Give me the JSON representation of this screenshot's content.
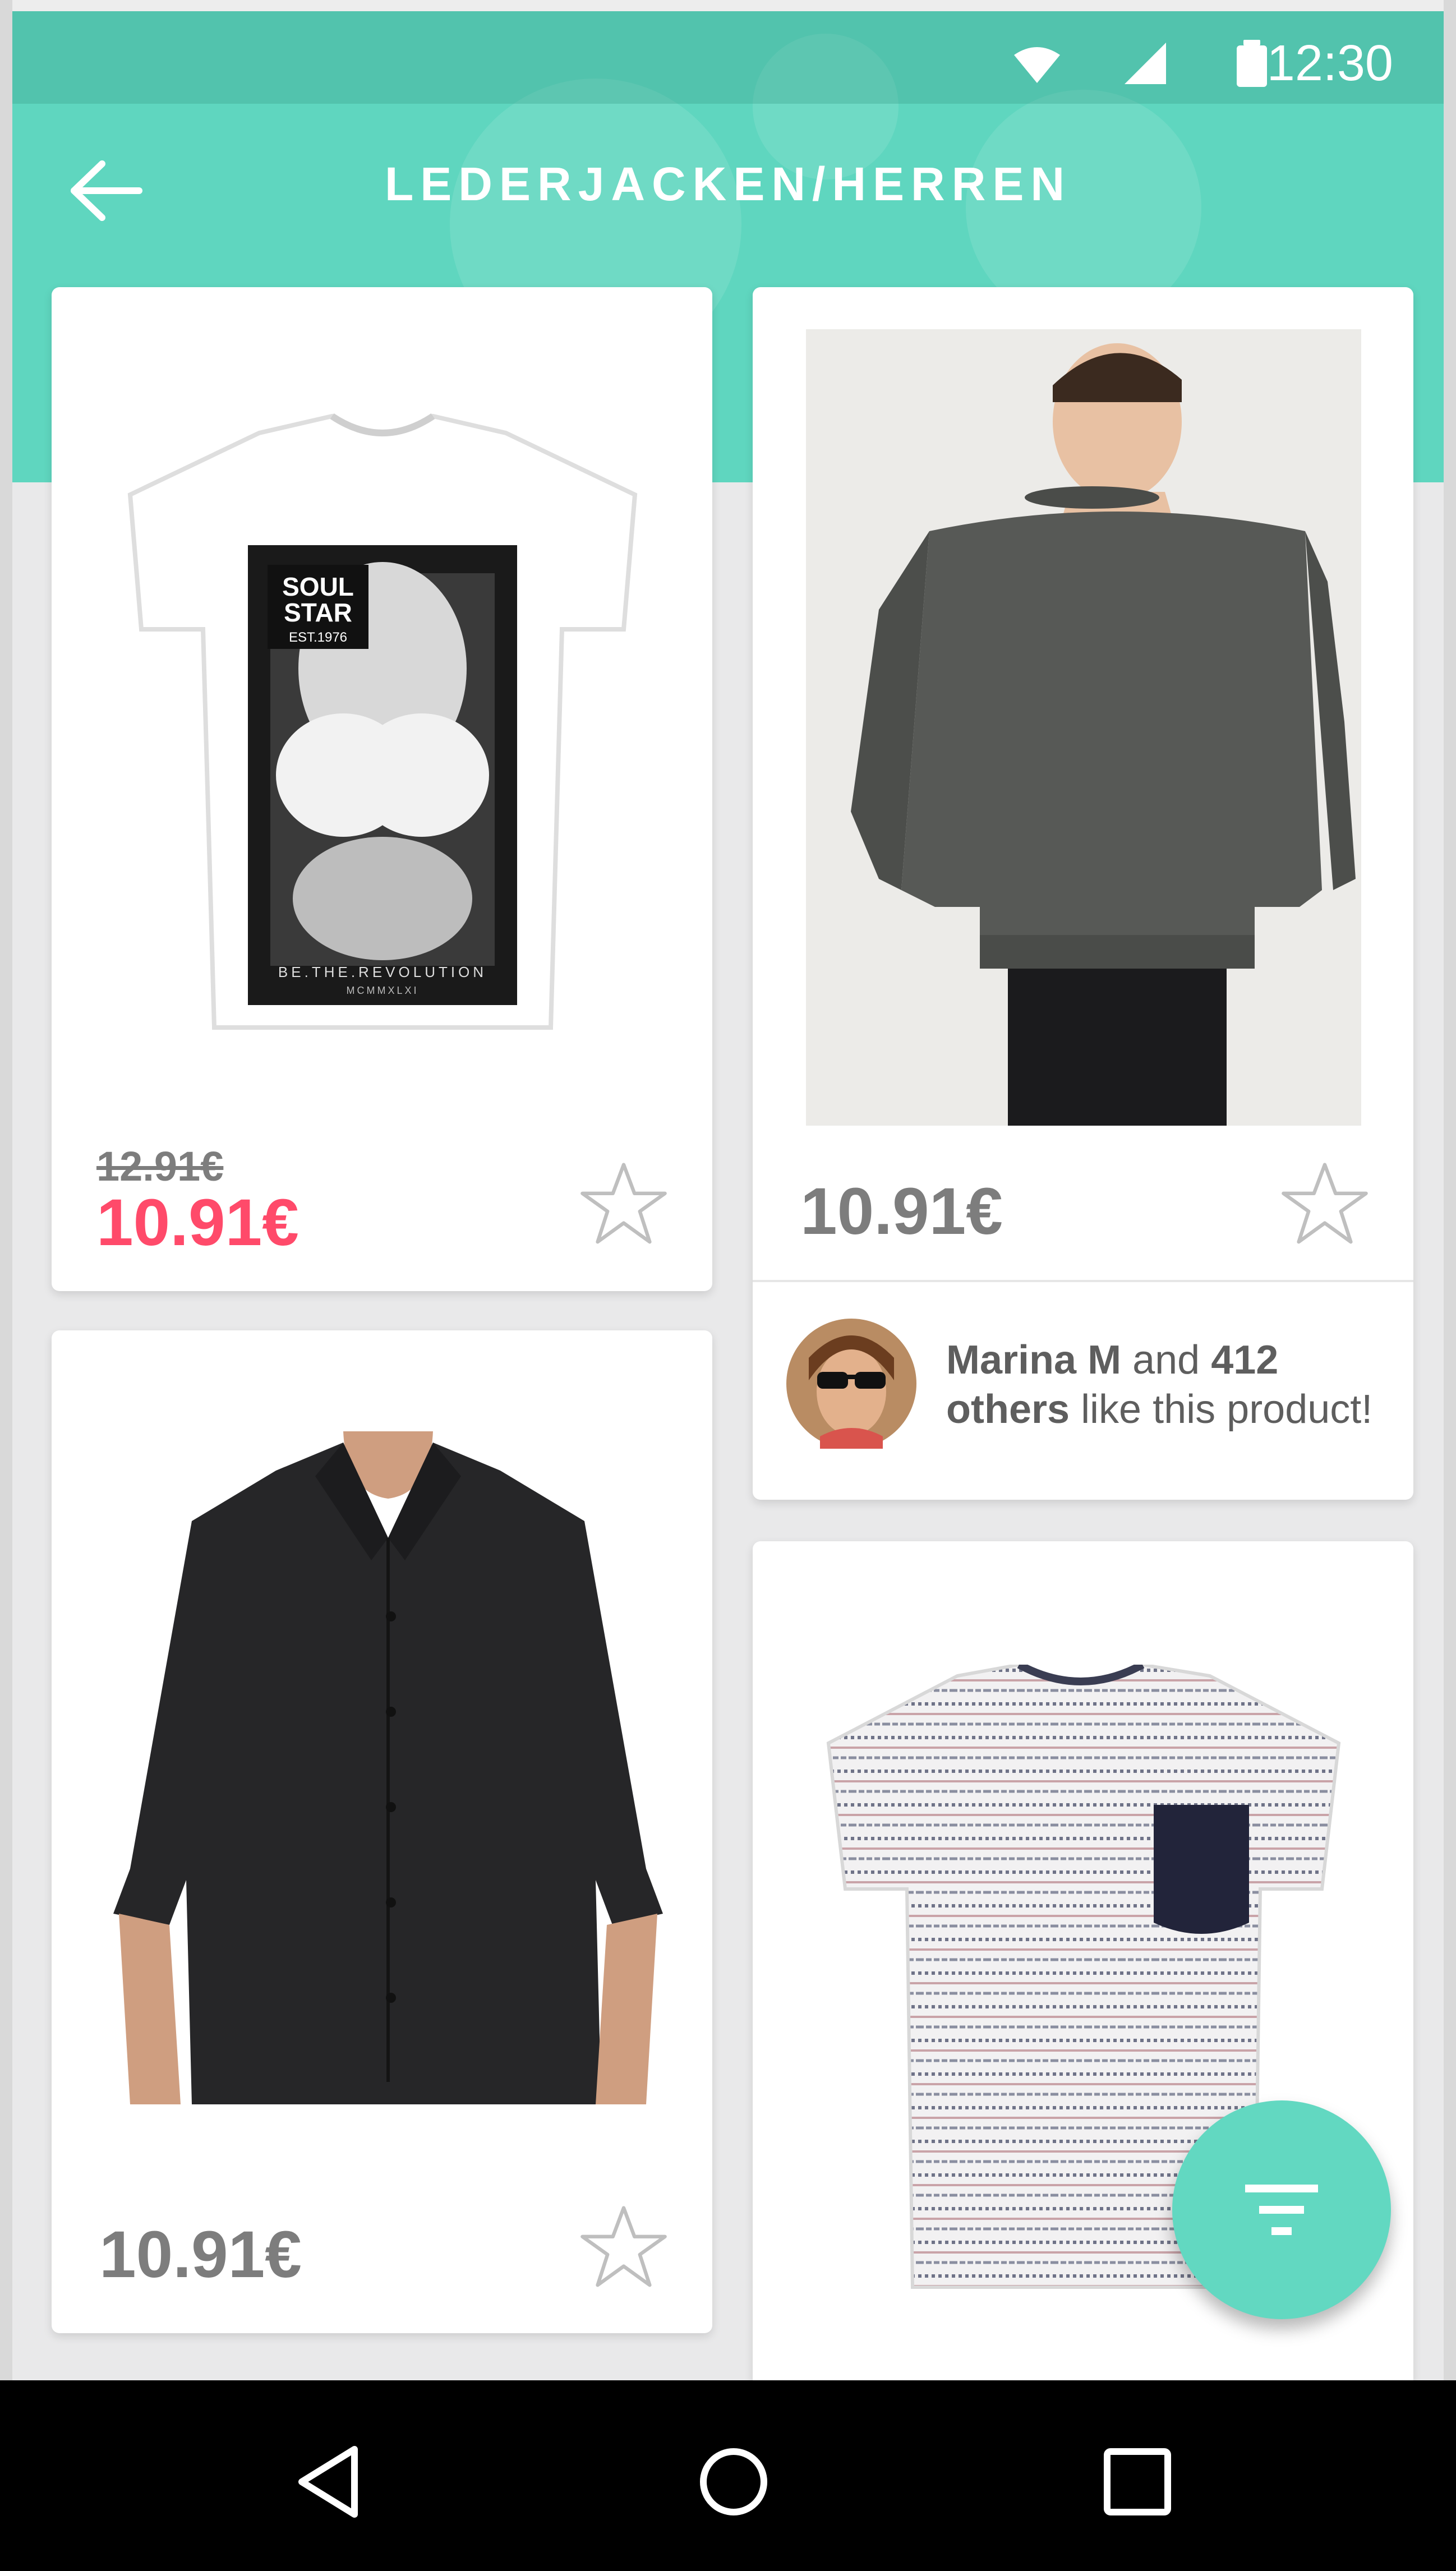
{
  "status_bar": {
    "time": "12:30"
  },
  "app_bar": {
    "title": "LEDERJACKEN/HERREN"
  },
  "products": [
    {
      "name": "graphic-tshirt-white",
      "old_price": "12.91€",
      "price": "10.91€",
      "tshirt_print": {
        "badge_line1": "SOUL",
        "badge_line2": "STAR",
        "badge_line3": "EST.1976",
        "bottom_text": "BE.THE.REVOLUTION",
        "bottom_subtext": "MCMMXLXI"
      }
    },
    {
      "name": "grey-sweater",
      "price": "10.91€",
      "social": {
        "name": "Marina M",
        "connector": "and",
        "count": "412",
        "suffix_bold": "others",
        "suffix": "like this product!"
      }
    },
    {
      "name": "black-shirt",
      "price": "10.91€"
    },
    {
      "name": "patterned-tshirt"
    }
  ],
  "colors": {
    "accent": "#5fd6bf",
    "sale": "#ff4a6a",
    "price_text": "#7d7d7d",
    "background": "#e9e9ea",
    "navbar": "#000000"
  },
  "icons": {
    "back": "arrow-left-icon",
    "wifi": "wifi-icon",
    "signal": "signal-icon",
    "battery": "battery-icon",
    "favorite": "star-outline-icon",
    "filter": "filter-icon",
    "nav_back": "triangle-back-icon",
    "nav_home": "circle-home-icon",
    "nav_recent": "square-recent-icon"
  }
}
